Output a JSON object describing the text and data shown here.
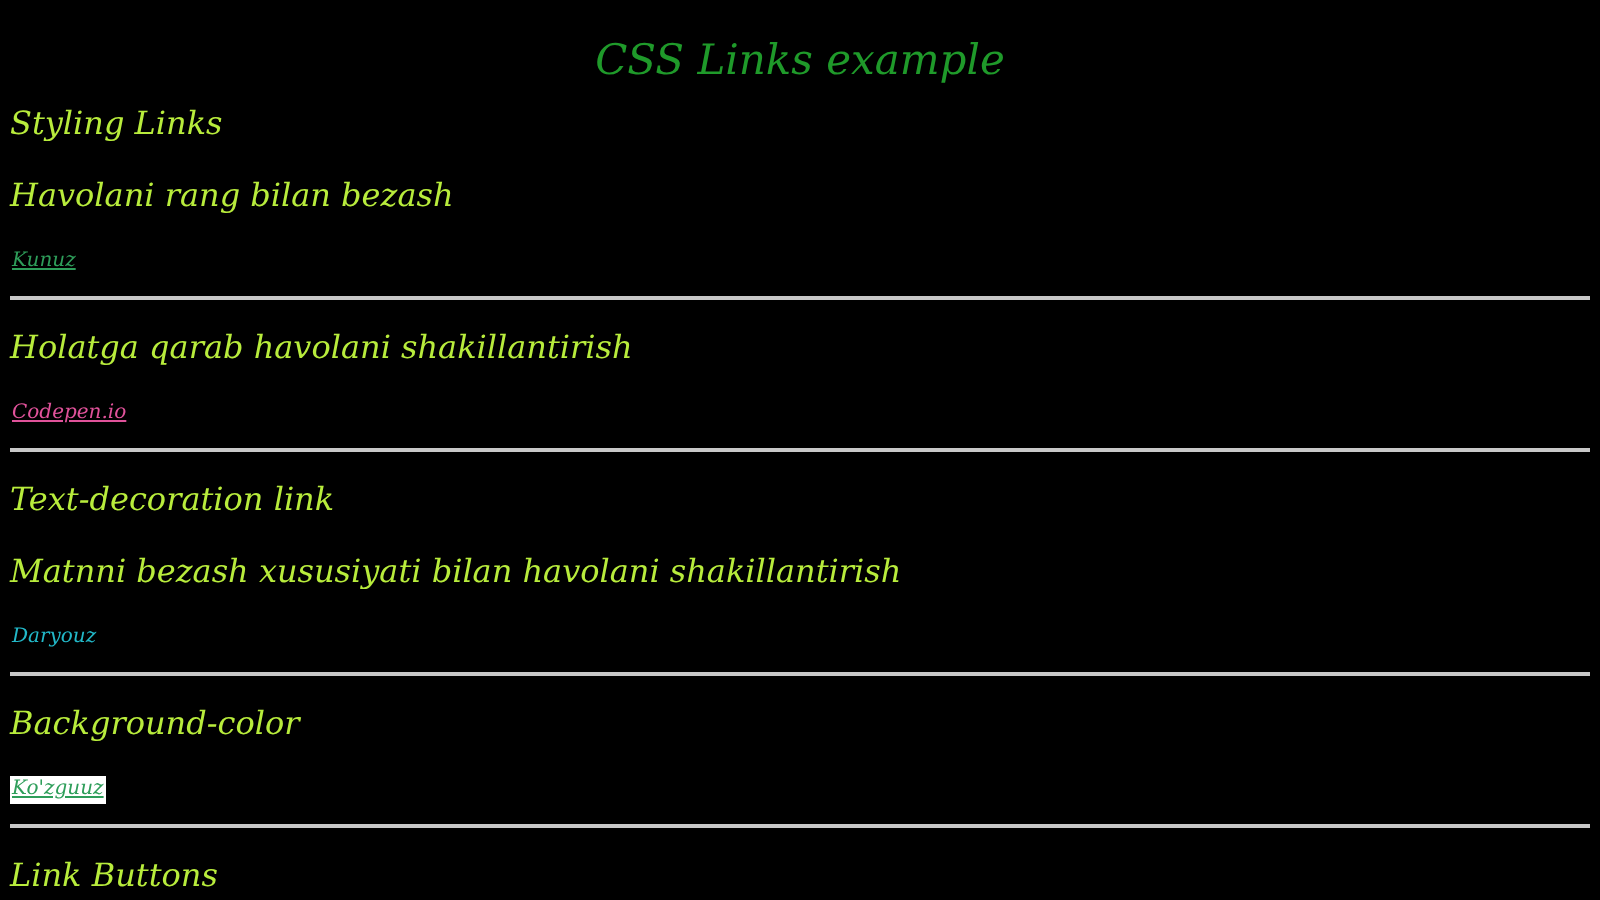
{
  "title": "CSS Links example",
  "blocks": [
    {
      "kind": "heading",
      "text": "Styling Links"
    },
    {
      "kind": "heading",
      "text": "Havolani rang bilan bezash"
    },
    {
      "kind": "link",
      "text": "Kunuz",
      "color": "#2e9e5a",
      "underline": true,
      "highlighted": false
    },
    {
      "kind": "rule"
    },
    {
      "kind": "heading",
      "text": "Holatga qarab havolani shakillantirish"
    },
    {
      "kind": "link",
      "text": "Codepen.io",
      "color": "#e0529a",
      "underline": true,
      "highlighted": false
    },
    {
      "kind": "rule"
    },
    {
      "kind": "heading",
      "text": "Text-decoration link"
    },
    {
      "kind": "heading",
      "text": "Matnni bezash xususiyati bilan havolani shakillantirish"
    },
    {
      "kind": "link",
      "text": "Daryouz",
      "color": "#22b8c8",
      "underline": false,
      "highlighted": false
    },
    {
      "kind": "rule"
    },
    {
      "kind": "heading",
      "text": "Background-color"
    },
    {
      "kind": "link",
      "text": "Ko'zguuz",
      "color": "#2e9e5a",
      "underline": true,
      "highlighted": true
    },
    {
      "kind": "rule"
    },
    {
      "kind": "heading",
      "text": "Link Buttons"
    }
  ]
}
